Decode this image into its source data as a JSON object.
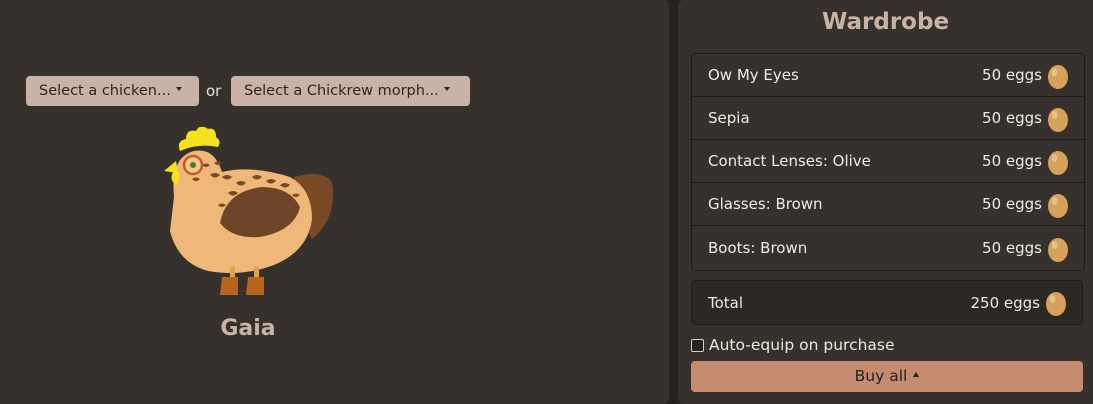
{
  "selector": {
    "chicken_label": "Select a chicken...",
    "or_text": "or",
    "morph_label": "Select a Chickrew morph..."
  },
  "chicken": {
    "name": "Gaia"
  },
  "wardrobe": {
    "title": "Wardrobe",
    "items": [
      {
        "name": "Ow My Eyes",
        "price": "50 eggs"
      },
      {
        "name": "Sepia",
        "price": "50 eggs"
      },
      {
        "name": "Contact Lenses: Olive",
        "price": "50 eggs"
      },
      {
        "name": "Glasses: Brown",
        "price": "50 eggs"
      },
      {
        "name": "Boots: Brown",
        "price": "50 eggs"
      }
    ],
    "total_label": "Total",
    "total_price": "250 eggs",
    "auto_equip_label": "Auto-equip on purchase",
    "auto_equip_checked": false,
    "buy_all_label": "Buy all"
  },
  "colors": {
    "background": "#26231f",
    "panel": "#36312d",
    "accent": "#c48b6e",
    "dropdown": "#c9b3a6",
    "egg": "#d4a25a"
  }
}
